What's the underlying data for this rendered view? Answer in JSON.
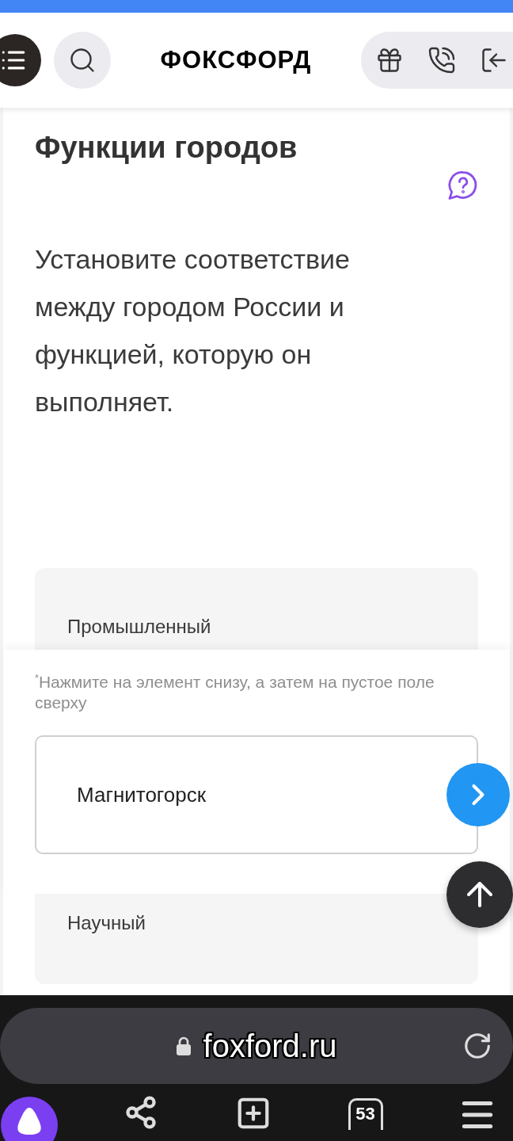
{
  "header": {
    "logo": "ФОКСФОРД"
  },
  "task": {
    "title": "Функции городов",
    "text": "Установите соответствие между городом России и функцией, которую он выполняет."
  },
  "functions": [
    {
      "label": "Промышленный"
    },
    {
      "label": "Научный"
    }
  ],
  "answer_panel": {
    "hint": "$^{*}$Нажмите на элемент снизу, а затем на пустое поле сверху",
    "cities": [
      {
        "label": "Магнитогорск"
      }
    ]
  },
  "browser": {
    "url": "foxford.ru",
    "tab_count": "53"
  }
}
